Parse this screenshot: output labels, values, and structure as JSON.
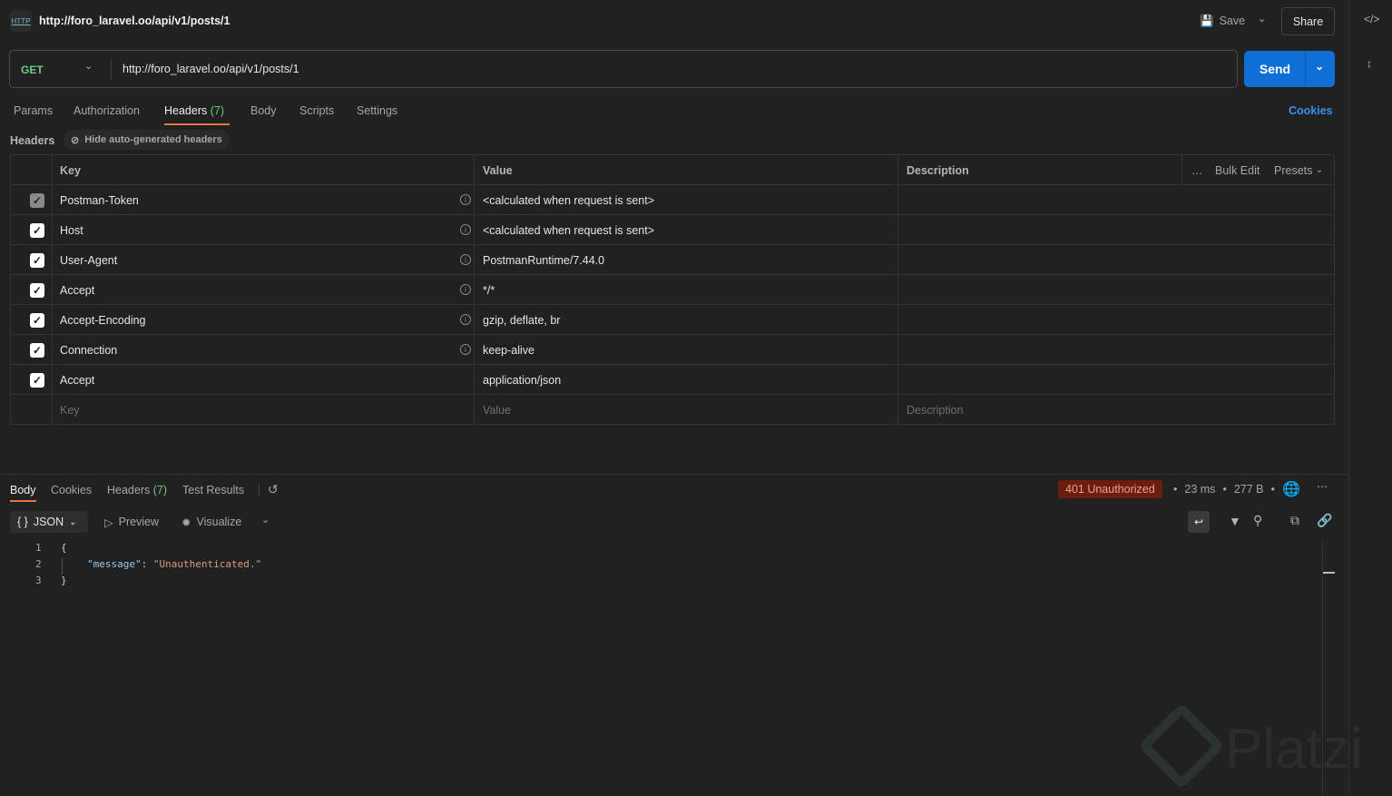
{
  "header": {
    "title": "http://foro_laravel.oo/api/v1/posts/1",
    "http_icon": "HTTP",
    "save": "Save",
    "share": "Share"
  },
  "request": {
    "method": "GET",
    "url": "http://foro_laravel.oo/api/v1/posts/1",
    "send": "Send"
  },
  "tabs": {
    "params": "Params",
    "authorization": "Authorization",
    "headers": "Headers",
    "headers_count": "(7)",
    "body": "Body",
    "scripts": "Scripts",
    "settings": "Settings",
    "cookies": "Cookies"
  },
  "headers_section": {
    "label": "Headers",
    "hide_auto": "Hide auto-generated headers"
  },
  "table": {
    "columns": {
      "key": "Key",
      "value": "Value",
      "description": "Description",
      "bulk_edit": "Bulk Edit",
      "presets": "Presets"
    },
    "rows": [
      {
        "key": "Postman-Token",
        "value": "<calculated when request is sent>",
        "checked": true,
        "disabled": true,
        "info": true
      },
      {
        "key": "Host",
        "value": "<calculated when request is sent>",
        "checked": true,
        "info": true
      },
      {
        "key": "User-Agent",
        "value": "PostmanRuntime/7.44.0",
        "checked": true,
        "info": true
      },
      {
        "key": "Accept",
        "value": "*/*",
        "checked": true,
        "info": true
      },
      {
        "key": "Accept-Encoding",
        "value": "gzip, deflate, br",
        "checked": true,
        "info": true
      },
      {
        "key": "Connection",
        "value": "keep-alive",
        "checked": true,
        "info": true
      },
      {
        "key": "Accept",
        "value": "application/json",
        "checked": true,
        "info": false
      }
    ],
    "placeholders": {
      "key": "Key",
      "value": "Value",
      "description": "Description"
    }
  },
  "response": {
    "tabs": {
      "body": "Body",
      "cookies": "Cookies",
      "headers": "Headers",
      "headers_count": "(7)",
      "test_results": "Test Results"
    },
    "status": "401 Unauthorized",
    "time": "23 ms",
    "size": "277 B",
    "format": "JSON",
    "preview": "Preview",
    "visualize": "Visualize",
    "lines": [
      {
        "n": "1",
        "text": "{"
      },
      {
        "n": "2",
        "key": "\"message\"",
        "colon": ": ",
        "value": "\"Unauthenticated.\""
      },
      {
        "n": "3",
        "text": "}"
      }
    ]
  },
  "watermark": "Platzi"
}
